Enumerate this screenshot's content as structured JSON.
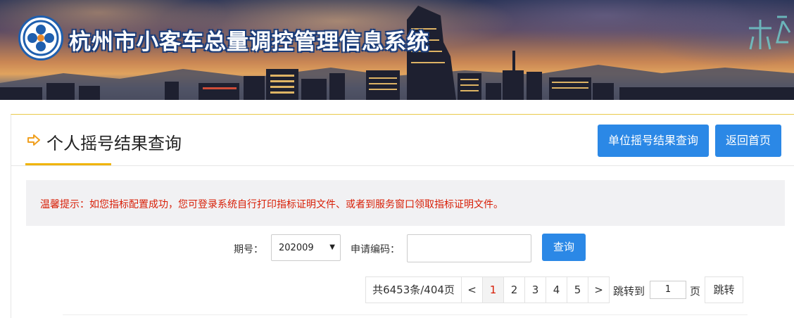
{
  "banner": {
    "title": "杭州市小客车总量调控管理信息系统",
    "colors": {
      "title_stroke": "#1b3d7a",
      "logo_blue": "#1f5fae"
    }
  },
  "header": {
    "page_title": "个人摇号结果查询",
    "company_button": "单位摇号结果查询",
    "home_button": "返回首页"
  },
  "notice": {
    "text": "温馨提示：如您指标配置成功，您可登录系统自行打印指标证明文件、或者到服务窗口领取指标证明文件。"
  },
  "search": {
    "period_label": "期号：",
    "period_value": "202009",
    "code_label": "申请编码：",
    "code_value": "",
    "query_button": "查询"
  },
  "pagination": {
    "total_text": "共6453条/404页",
    "prev": "<",
    "pages": [
      "1",
      "2",
      "3",
      "4",
      "5"
    ],
    "current_page": "1",
    "next": ">",
    "jump_label": "跳转到",
    "jump_value": "1",
    "page_unit": "页",
    "jump_button": "跳转"
  },
  "colors": {
    "accent_blue": "#2b88e6",
    "notice_red": "#d81e06",
    "title_underline": "#f0b400"
  }
}
